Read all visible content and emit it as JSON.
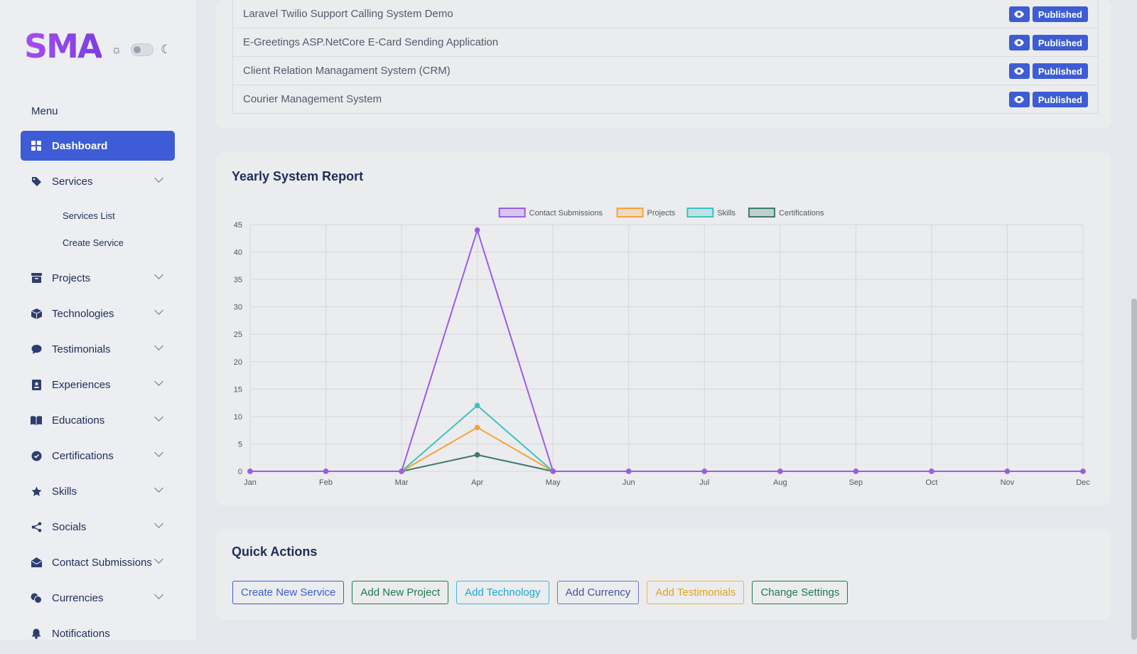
{
  "brand": {
    "logo": "SMA"
  },
  "sidebar": {
    "menu_title": "Menu",
    "items": [
      {
        "label": "Dashboard",
        "icon": "dashboard-icon",
        "active": true
      },
      {
        "label": "Services",
        "icon": "tag-icon",
        "expanded": true,
        "children": [
          {
            "label": "Services List"
          },
          {
            "label": "Create Service"
          }
        ]
      },
      {
        "label": "Projects",
        "icon": "archive-icon"
      },
      {
        "label": "Technologies",
        "icon": "cube-icon"
      },
      {
        "label": "Testimonials",
        "icon": "chat-icon"
      },
      {
        "label": "Experiences",
        "icon": "id-badge-icon"
      },
      {
        "label": "Educations",
        "icon": "book-icon"
      },
      {
        "label": "Certifications",
        "icon": "award-icon"
      },
      {
        "label": "Skills",
        "icon": "star-icon"
      },
      {
        "label": "Socials",
        "icon": "share-icon"
      },
      {
        "label": "Contact Submissions",
        "icon": "envelope-icon"
      },
      {
        "label": "Currencies",
        "icon": "coins-icon"
      },
      {
        "label": "Notifications",
        "icon": "bell-icon"
      }
    ]
  },
  "projects": {
    "rows": [
      {
        "name": "Laravel Twilio Support Calling System Demo",
        "status": "Published"
      },
      {
        "name": "E-Greetings ASP.NetCore E-Card Sending Application",
        "status": "Published"
      },
      {
        "name": "Client Relation Managament System (CRM)",
        "status": "Published"
      },
      {
        "name": "Courier Management System",
        "status": "Published"
      }
    ]
  },
  "report": {
    "title": "Yearly System Report"
  },
  "chart_data": {
    "type": "line",
    "title": "",
    "xlabel": "",
    "ylabel": "",
    "categories": [
      "Jan",
      "Feb",
      "Mar",
      "Apr",
      "May",
      "Jun",
      "Jul",
      "Aug",
      "Sep",
      "Oct",
      "Nov",
      "Dec"
    ],
    "ylim": [
      0,
      45
    ],
    "yticks": [
      0,
      5,
      10,
      15,
      20,
      25,
      30,
      35,
      40,
      45
    ],
    "grid": true,
    "legend_position": "top",
    "series": [
      {
        "name": "Contact Submissions",
        "color": "#9b5de5",
        "values": [
          0,
          0,
          0,
          44,
          0,
          0,
          0,
          0,
          0,
          0,
          0,
          0
        ]
      },
      {
        "name": "Projects",
        "color": "#f4a23c",
        "values": [
          0,
          0,
          0,
          8,
          0,
          0,
          0,
          0,
          0,
          0,
          0,
          0
        ]
      },
      {
        "name": "Skills",
        "color": "#3fc1c0",
        "values": [
          0,
          0,
          0,
          12,
          0,
          0,
          0,
          0,
          0,
          0,
          0,
          0
        ]
      },
      {
        "name": "Certifications",
        "color": "#3d7a6e",
        "values": [
          0,
          0,
          0,
          3,
          0,
          0,
          0,
          0,
          0,
          0,
          0,
          0
        ]
      }
    ]
  },
  "quick_actions": {
    "title": "Quick Actions",
    "buttons": [
      {
        "label": "Create New Service"
      },
      {
        "label": "Add New Project"
      },
      {
        "label": "Add Technology"
      },
      {
        "label": "Add Currency"
      },
      {
        "label": "Add Testimonials"
      },
      {
        "label": "Change Settings"
      }
    ]
  }
}
